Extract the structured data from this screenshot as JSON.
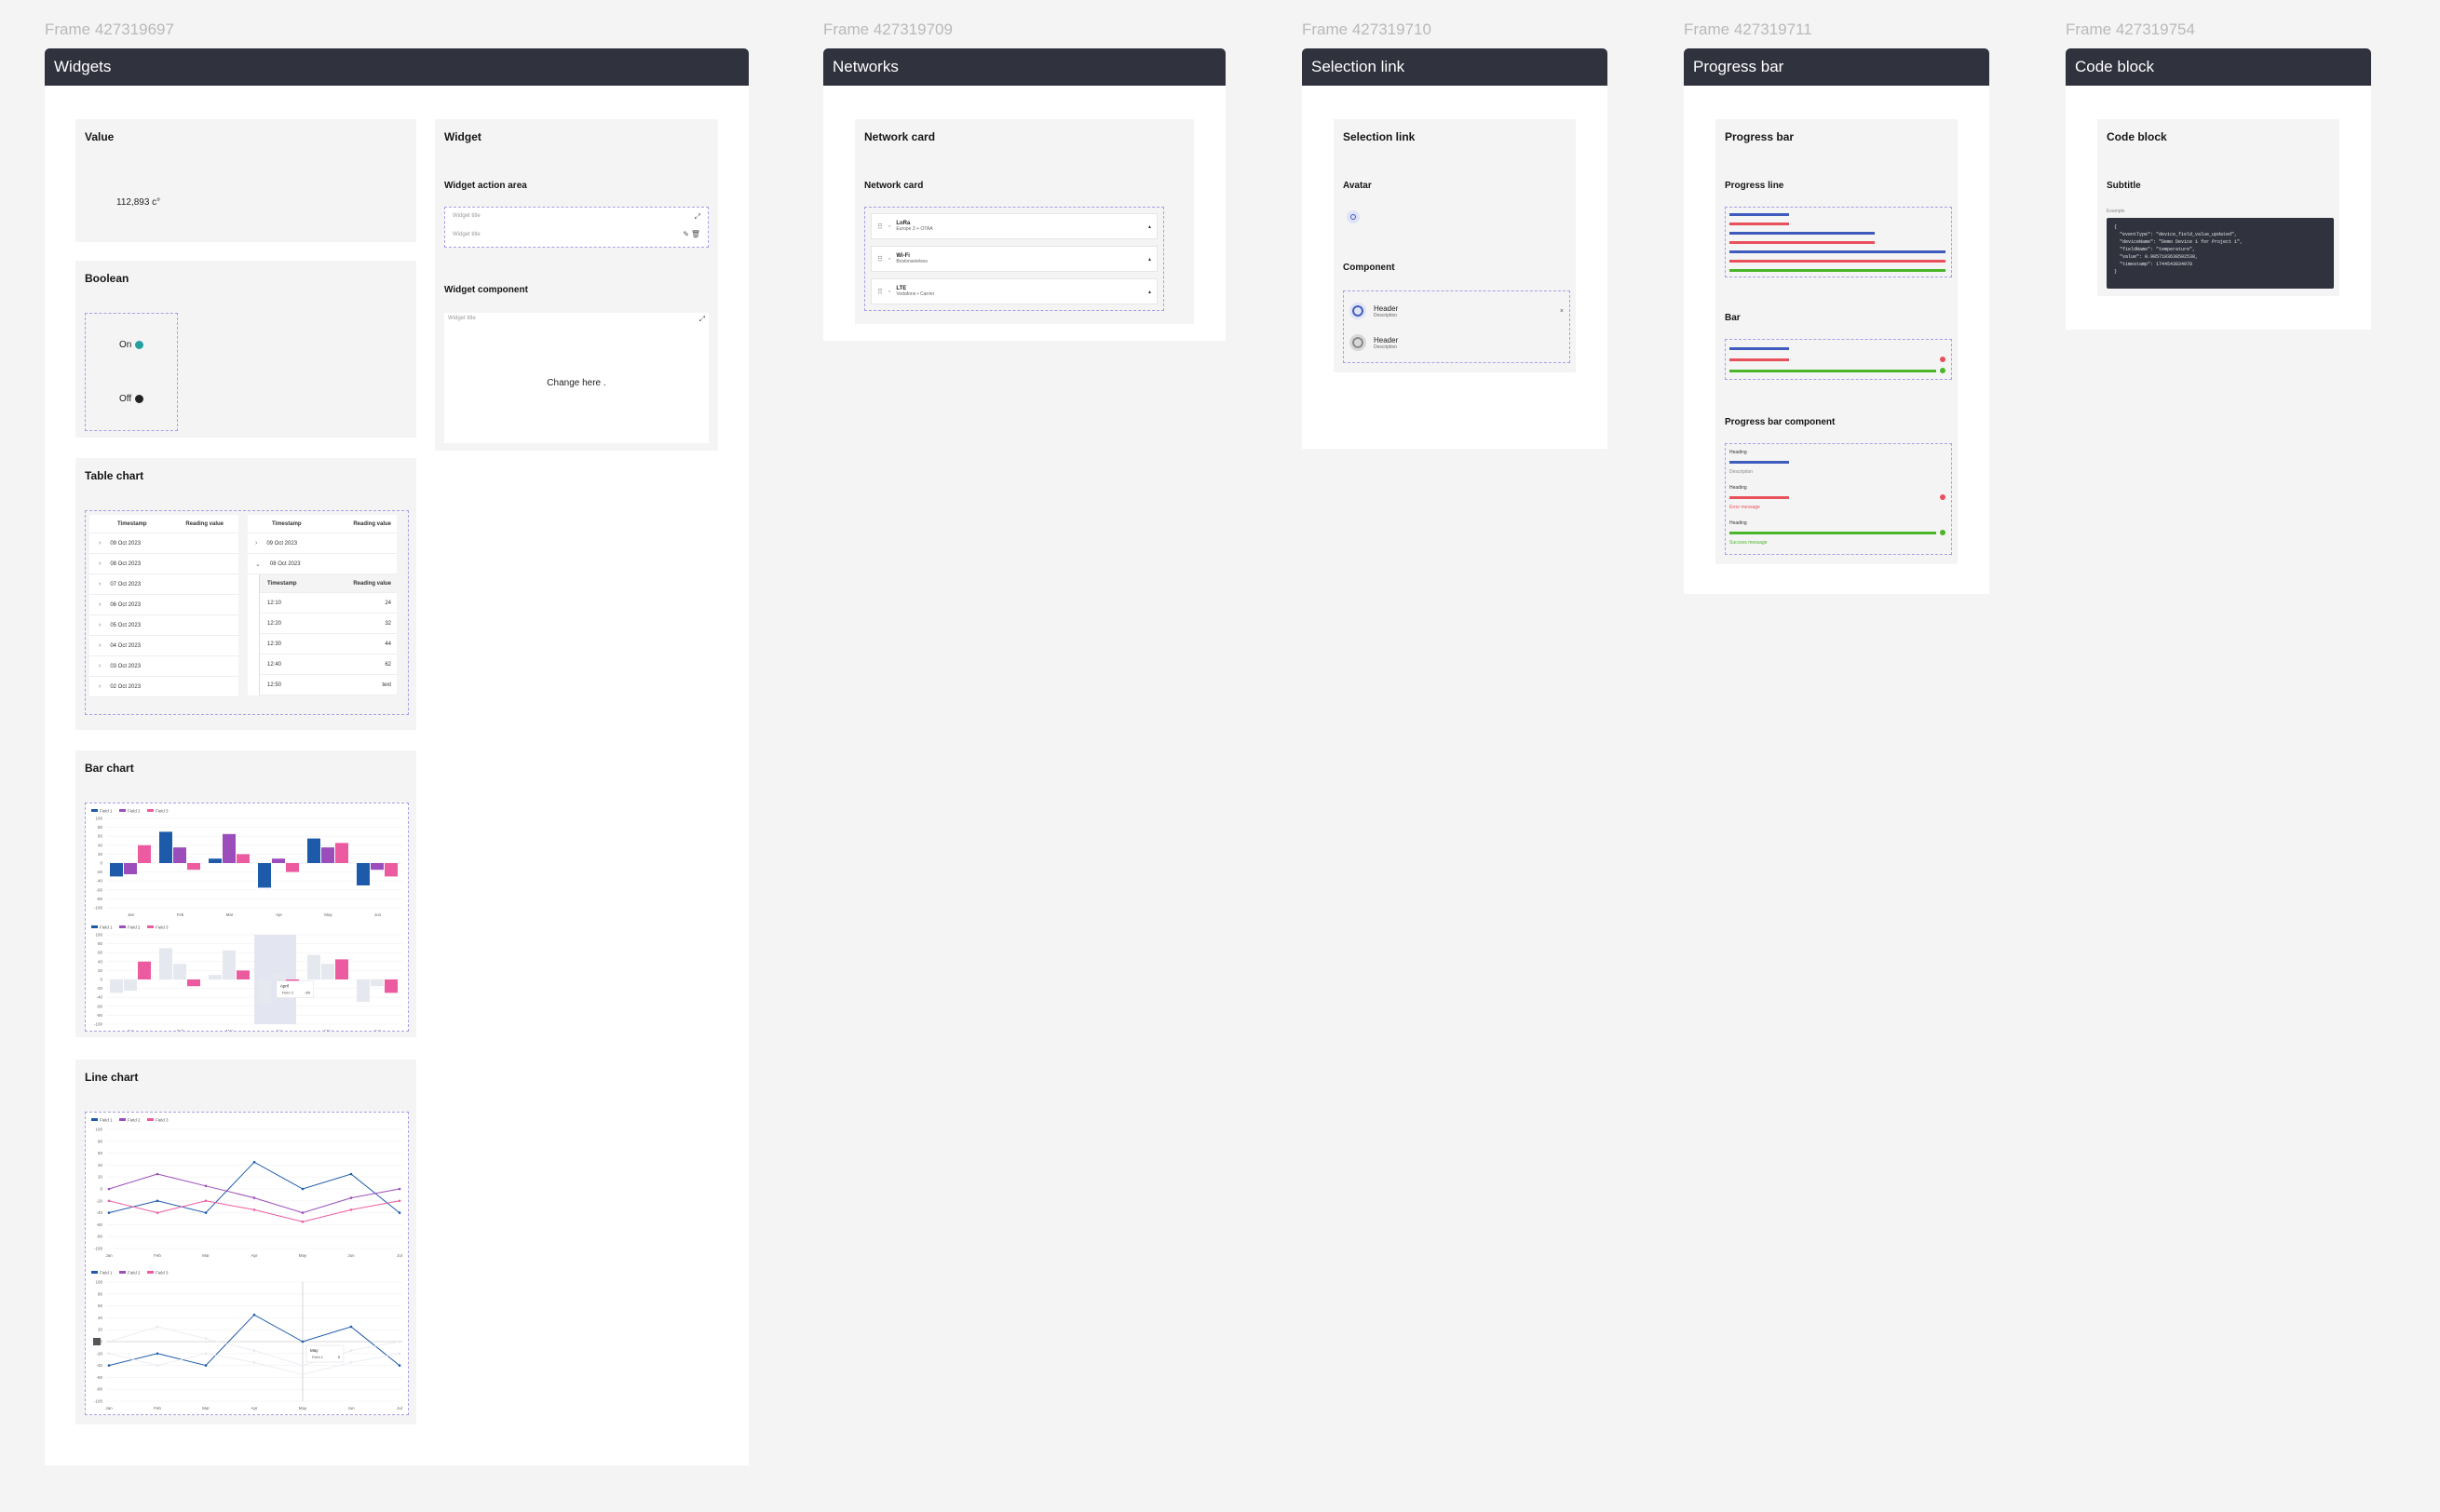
{
  "frames": {
    "widgets": {
      "frame_name": "Frame 427319697",
      "title": "Widgets"
    },
    "networks": {
      "frame_name": "Frame 427319709",
      "title": "Networks"
    },
    "selection": {
      "frame_name": "Frame 427319710",
      "title": "Selection link"
    },
    "progress": {
      "frame_name": "Frame 427319711",
      "title": "Progress bar"
    },
    "code": {
      "frame_name": "Frame 427319754",
      "title": "Code block"
    }
  },
  "value_card": {
    "title": "Value",
    "value": "112,893 c°"
  },
  "boolean_card": {
    "title": "Boolean",
    "on_label": "On",
    "off_label": "Off"
  },
  "widget_card": {
    "title": "Widget",
    "action_area_title": "Widget action area",
    "widget_title_1": "Widget title",
    "widget_title_2": "Widget title",
    "component_title": "Widget component",
    "component_widget_title": "Widget title",
    "change_here": "Change here ."
  },
  "table_chart": {
    "title": "Table chart",
    "col_timestamp": "Timestamp",
    "col_reading": "Reading value",
    "left_rows": [
      "09 Oct 2023",
      "08 Oct 2023",
      "07 Oct 2023",
      "06 Oct 2023",
      "05 Oct 2023",
      "04 Oct 2023",
      "03 Oct 2023",
      "02 Oct 2023"
    ],
    "right_rows": [
      "09 Oct 2023",
      "08 Oct 2023"
    ],
    "nested_rows": [
      {
        "time": "12:10",
        "value": "24"
      },
      {
        "time": "12:20",
        "value": "32"
      },
      {
        "time": "12:30",
        "value": "44"
      },
      {
        "time": "12:40",
        "value": "62"
      },
      {
        "time": "12:50",
        "value": "text"
      }
    ]
  },
  "network_card": {
    "title": "Network card",
    "subtitle": "Network card",
    "items": [
      {
        "name": "LoRa",
        "detail": "Europe 3 + OTAA"
      },
      {
        "name": "Wi-Fi",
        "detail": "Bostonwireless"
      },
      {
        "name": "LTE",
        "detail": "Vodafone • Carrier"
      }
    ]
  },
  "selection_link": {
    "title": "Selection link",
    "avatar_title": "Avatar",
    "component_title": "Component",
    "items": [
      {
        "header": "Header",
        "description": "Description"
      },
      {
        "header": "Header",
        "description": "Description"
      }
    ]
  },
  "progress_bar": {
    "title": "Progress bar",
    "line_title": "Progress line",
    "bar_title": "Bar",
    "component_title": "Progress bar component",
    "components": [
      {
        "heading": "Heading",
        "message": "Description",
        "color": "#3e5bbd"
      },
      {
        "heading": "Heading",
        "message": "Error message",
        "color": "#e8505b"
      },
      {
        "heading": "Heading",
        "message": "Success message",
        "color": "#4bb52a"
      }
    ],
    "colors": {
      "blue": "#3e5bbd",
      "red": "#e8505b",
      "green": "#4bb52a"
    }
  },
  "code_block": {
    "title": "Code block",
    "subtitle": "Subtitle",
    "example_label": "Example",
    "lines": [
      "{",
      "\"eventType\": \"device_field_value_updated\",",
      "\"deviceName\": \"Demo Device 1 for Project 1\",",
      "\"fieldName\": \"temperature\",",
      "\"value\": 0.9857103638502538,",
      "\"timestamp\": 1744543834978",
      "}"
    ]
  },
  "bar_chart": {
    "title": "Bar chart",
    "chart_data": {
      "type": "bar",
      "categories": [
        "Jan",
        "Feb",
        "Mar",
        "Apr",
        "May",
        "Jun"
      ],
      "series": [
        {
          "name": "Field 1",
          "values": [
            -30,
            70,
            10,
            -55,
            55,
            -50
          ]
        },
        {
          "name": "Field 2",
          "values": [
            -25,
            35,
            65,
            10,
            35,
            -15
          ]
        },
        {
          "name": "Field 3",
          "values": [
            40,
            -15,
            20,
            -20,
            45,
            -30
          ]
        }
      ],
      "ylim": [
        -100,
        100
      ],
      "yticks": [
        "100",
        "80",
        "60",
        "40",
        "20",
        "0",
        "-20",
        "-40",
        "-60",
        "-80",
        "-100"
      ],
      "colors": [
        "#1e5aaa",
        "#9b4dbb",
        "#ec5b9f"
      ],
      "tooltip": {
        "label": "April",
        "series": "Field 3",
        "value": "-20"
      }
    }
  },
  "line_chart": {
    "title": "Line chart",
    "chart_data": {
      "type": "line",
      "categories": [
        "Jan",
        "Feb",
        "Mar",
        "Apr",
        "May",
        "Jun",
        "Jul"
      ],
      "series": [
        {
          "name": "Field 1",
          "values": [
            -40,
            -20,
            -40,
            45,
            0,
            25,
            -40
          ]
        },
        {
          "name": "Field 2",
          "values": [
            0,
            25,
            5,
            -15,
            -40,
            -15,
            0
          ]
        },
        {
          "name": "Field 3",
          "values": [
            -20,
            -40,
            -20,
            -35,
            -55,
            -35,
            -20
          ]
        }
      ],
      "ylim": [
        -100,
        100
      ],
      "yticks": [
        "100",
        "80",
        "60",
        "40",
        "20",
        "0",
        "-20",
        "-40",
        "-60",
        "-80",
        "-100"
      ],
      "colors": [
        "#1e5aaa",
        "#9b4dbb",
        "#ec5b9f"
      ],
      "tooltip": {
        "label": "May",
        "series": "Field 1",
        "value": "0"
      }
    }
  }
}
